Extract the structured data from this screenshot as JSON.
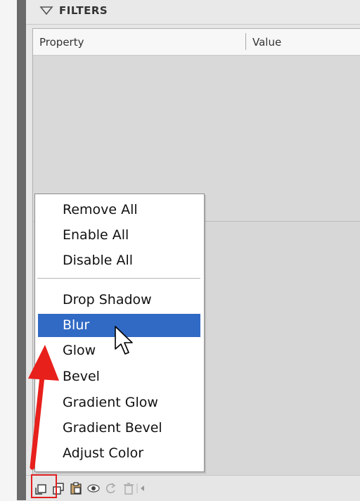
{
  "panel": {
    "title": "FILTERS"
  },
  "grid": {
    "columns": [
      "Property",
      "Value"
    ]
  },
  "context_menu": {
    "items": [
      "Remove All",
      "Enable All",
      "Disable All",
      "Drop Shadow",
      "Blur",
      "Glow",
      "Bevel",
      "Gradient Glow",
      "Gradient Bevel",
      "Adjust Color"
    ],
    "selected": "Blur"
  },
  "toolbar": {
    "icons": [
      "add-filter-icon",
      "duplicate-icon",
      "paste-icon",
      "eye-icon",
      "reset-icon",
      "delete-icon",
      "scroll-left-icon"
    ]
  },
  "colors": {
    "selection": "#316ac5",
    "annotation": "#e02020"
  }
}
